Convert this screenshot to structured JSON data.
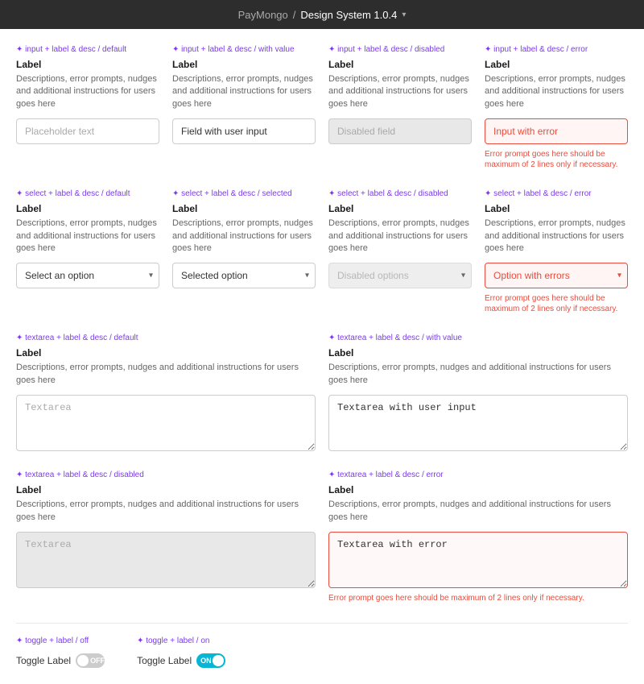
{
  "topbar": {
    "brand": "PayMongo",
    "separator": "/",
    "title": "Design System 1.0.4",
    "chevron": "▾"
  },
  "sections": {
    "input_default": {
      "type": "✦ input + label & desc / default",
      "label": "Label",
      "desc": "Descriptions, error prompts, nudges and additional instructions for users goes here",
      "placeholder": "Placeholder text",
      "value": ""
    },
    "input_value": {
      "type": "✦ input + label & desc / with value",
      "label": "Label",
      "desc": "Descriptions, error prompts, nudges and additional instructions for users goes here",
      "placeholder": "",
      "value": "Field with user input"
    },
    "input_disabled": {
      "type": "✦ input + label & desc / disabled",
      "label": "Label",
      "desc": "Descriptions, error prompts, nudges and additional instructions for users goes here",
      "placeholder": "Disabled field",
      "value": ""
    },
    "input_error": {
      "type": "✦ input + label & desc / error",
      "label": "Label",
      "desc": "Descriptions, error prompts, nudges and additional instructions for users goes here",
      "placeholder": "",
      "value": "Input with error",
      "error": "Error prompt goes here should be maximum of 2 lines only if necessary."
    },
    "select_default": {
      "type": "✦ select + label & desc / default",
      "label": "Label",
      "desc": "Descriptions, error prompts, nudges and additional instructions for users goes here",
      "placeholder": "Select an option"
    },
    "select_selected": {
      "type": "✦ select + label & desc / selected",
      "label": "Label",
      "desc": "Descriptions, error prompts, nudges and additional instructions for users goes here",
      "value": "Selected option"
    },
    "select_disabled": {
      "type": "✦ select + label & desc / disabled",
      "label": "Label",
      "desc": "Descriptions, error prompts, nudges and additional instructions for users goes here",
      "value": "Disabled options"
    },
    "select_error": {
      "type": "✦ select + label & desc / error",
      "label": "Label",
      "desc": "Descriptions, error prompts, nudges and additional instructions for users goes here",
      "value": "Option with errors",
      "error": "Error prompt goes here should be maximum of 2 lines only if necessary."
    },
    "textarea_default": {
      "type": "✦ textarea + label & desc / default",
      "label": "Label",
      "desc": "Descriptions, error prompts, nudges and additional instructions for users goes here",
      "placeholder": "Textarea",
      "value": ""
    },
    "textarea_value": {
      "type": "✦ textarea + label & desc / with value",
      "label": "Label",
      "desc": "Descriptions, error prompts, nudges and additional instructions for users goes here",
      "placeholder": "",
      "value": "Textarea with user input"
    },
    "textarea_disabled": {
      "type": "✦ textarea + label & desc / disabled",
      "label": "Label",
      "desc": "Descriptions, error prompts, nudges and additional instructions for users goes here",
      "placeholder": "Textarea",
      "value": ""
    },
    "textarea_error": {
      "type": "✦ textarea + label & desc / error",
      "label": "Label",
      "desc": "Descriptions, error prompts, nudges and additional instructions for users goes here",
      "placeholder": "",
      "value": "Textarea with error",
      "error": "Error prompt goes here should be maximum of 2 lines only if necessary."
    },
    "toggle_off": {
      "type": "✦ toggle + label / off",
      "label": "Toggle Label",
      "state": "OFF"
    },
    "toggle_on": {
      "type": "✦ toggle + label / on",
      "label": "Toggle Label",
      "state": "ON"
    }
  }
}
